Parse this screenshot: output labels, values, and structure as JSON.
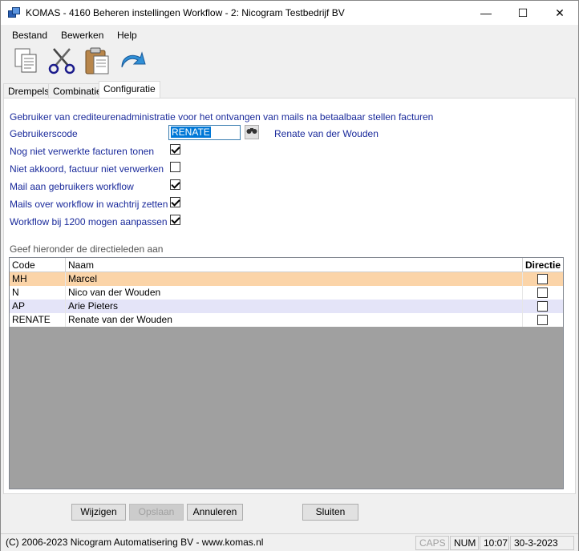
{
  "window": {
    "title": "KOMAS - 4160 Beheren instellingen Workflow - 2: Nicogram Testbedrijf BV",
    "minimize": "—",
    "maximize": "☐",
    "close": "✕"
  },
  "menu": [
    {
      "label": "Bestand"
    },
    {
      "label": "Bewerken"
    },
    {
      "label": "Help"
    }
  ],
  "toolbar": [
    {
      "icon": "copy-documents-icon"
    },
    {
      "icon": "scissors-icon"
    },
    {
      "icon": "clipboard-icon"
    },
    {
      "icon": "undo-arrow-icon"
    }
  ],
  "tabs": [
    {
      "label": "Drempels",
      "active": false
    },
    {
      "label": "Combinatie",
      "active": false
    },
    {
      "label": "Configuratie",
      "active": true
    }
  ],
  "config": {
    "heading": "Gebruiker van crediteurenadministratie voor het ontvangen van mails na betaalbaar stellen facturen",
    "user_code_label": "Gebruikerscode",
    "user_code_value": "RENATE",
    "user_name": "Renate van der Wouden",
    "options": [
      {
        "label": "Nog niet verwerkte facturen tonen",
        "checked": true
      },
      {
        "label": "Niet akkoord, factuur niet verwerken",
        "checked": false
      },
      {
        "label": "Mail aan gebruikers workflow",
        "checked": true
      },
      {
        "label": "Mails over workflow in wachtrij zetten",
        "checked": true
      },
      {
        "label": "Workflow bij 1200 mogen aanpassen",
        "checked": true
      }
    ],
    "directors_heading": "Geef hieronder de directieleden aan"
  },
  "grid": {
    "columns": [
      "Code",
      "Naam",
      "Directie"
    ],
    "rows": [
      {
        "code": "MH",
        "name": "Marcel",
        "directie": false
      },
      {
        "code": "N",
        "name": "Nico van der Wouden",
        "directie": false
      },
      {
        "code": "AP",
        "name": "Arie Pieters",
        "directie": false
      },
      {
        "code": "RENATE",
        "name": "Renate van der Wouden",
        "directie": false
      }
    ]
  },
  "buttons": {
    "edit": "Wijzigen",
    "save": "Opslaan",
    "cancel": "Annuleren",
    "close": "Sluiten"
  },
  "status": {
    "copyright": "(C) 2006-2023 Nicogram Automatisering BV - www.komas.nl",
    "caps": "CAPS",
    "num": "NUM",
    "time": "10:07",
    "date": "30-3-2023"
  },
  "colors": {
    "label_blue": "#1a2a9b",
    "row_selected": "#fbd4a8",
    "row_alt": "#e4e4f8"
  }
}
